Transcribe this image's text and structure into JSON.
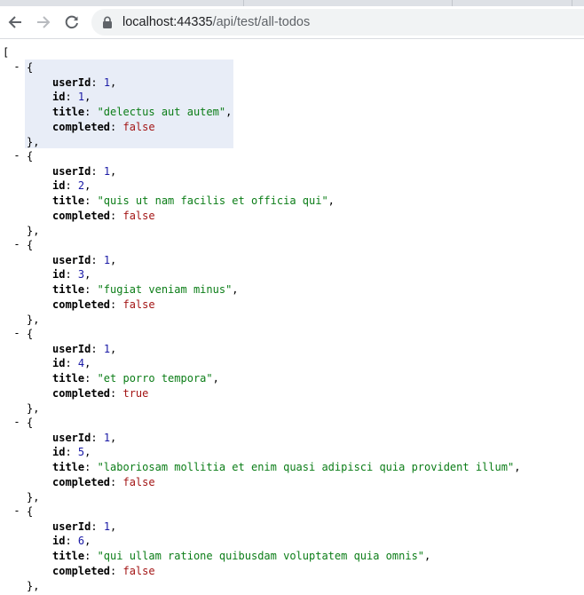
{
  "window": {
    "url_host": "localhost:44335",
    "url_path": "/api/test/all-todos"
  },
  "json_view": {
    "open_bracket": "[",
    "collapser": "-",
    "open_brace": "{",
    "close_brace": "},",
    "keys": {
      "userId": "userId",
      "id": "id",
      "title": "title",
      "completed": "completed"
    },
    "items": [
      {
        "userId": "1",
        "id": "1",
        "title": "\"delectus aut autem\"",
        "completed": "false"
      },
      {
        "userId": "1",
        "id": "2",
        "title": "\"quis ut nam facilis et officia qui\"",
        "completed": "false"
      },
      {
        "userId": "1",
        "id": "3",
        "title": "\"fugiat veniam minus\"",
        "completed": "false"
      },
      {
        "userId": "1",
        "id": "4",
        "title": "\"et porro tempora\"",
        "completed": "true"
      },
      {
        "userId": "1",
        "id": "5",
        "title": "\"laboriosam mollitia et enim quasi adipisci quia provident illum\"",
        "completed": "false"
      },
      {
        "userId": "1",
        "id": "6",
        "title": "\"qui ullam ratione quibusdam voluptatem quia omnis\"",
        "completed": "false"
      }
    ]
  }
}
